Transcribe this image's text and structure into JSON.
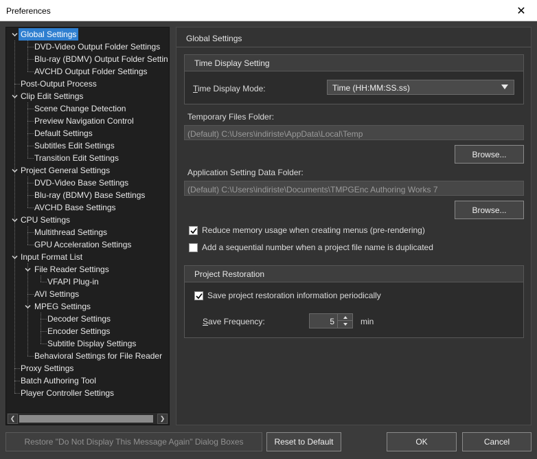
{
  "window": {
    "title": "Preferences"
  },
  "tree": {
    "items": [
      {
        "label": "Global Settings",
        "depth": 0,
        "toggle": "expanded",
        "selected": true
      },
      {
        "label": "DVD-Video Output Folder Settings",
        "depth": 1
      },
      {
        "label": "Blu-ray (BDMV) Output Folder Settin",
        "depth": 1
      },
      {
        "label": "AVCHD Output Folder Settings",
        "depth": 1
      },
      {
        "label": "Post-Output Process",
        "depth": 0
      },
      {
        "label": "Clip Edit Settings",
        "depth": 0,
        "toggle": "expanded"
      },
      {
        "label": "Scene Change Detection",
        "depth": 1
      },
      {
        "label": "Preview Navigation Control",
        "depth": 1
      },
      {
        "label": "Default Settings",
        "depth": 1
      },
      {
        "label": "Subtitles Edit Settings",
        "depth": 1
      },
      {
        "label": "Transition Edit Settings",
        "depth": 1
      },
      {
        "label": "Project General Settings",
        "depth": 0,
        "toggle": "expanded"
      },
      {
        "label": "DVD-Video Base Settings",
        "depth": 1
      },
      {
        "label": "Blu-ray (BDMV) Base Settings",
        "depth": 1
      },
      {
        "label": "AVCHD Base Settings",
        "depth": 1
      },
      {
        "label": "CPU Settings",
        "depth": 0,
        "toggle": "expanded"
      },
      {
        "label": "Multithread Settings",
        "depth": 1
      },
      {
        "label": "GPU Acceleration Settings",
        "depth": 1
      },
      {
        "label": "Input Format List",
        "depth": 0,
        "toggle": "expanded"
      },
      {
        "label": "File Reader Settings",
        "depth": 1,
        "toggle": "expanded"
      },
      {
        "label": "VFAPI Plug-in",
        "depth": 2
      },
      {
        "label": "AVI Settings",
        "depth": 1
      },
      {
        "label": "MPEG Settings",
        "depth": 1,
        "toggle": "expanded"
      },
      {
        "label": "Decoder Settings",
        "depth": 2
      },
      {
        "label": "Encoder Settings",
        "depth": 2
      },
      {
        "label": "Subtitle Display Settings",
        "depth": 2
      },
      {
        "label": "Behavioral Settings for File Reader",
        "depth": 1
      },
      {
        "label": "Proxy Settings",
        "depth": 0
      },
      {
        "label": "Batch Authoring Tool",
        "depth": 0
      },
      {
        "label": "Player Controller Settings",
        "depth": 0
      }
    ]
  },
  "panel": {
    "title": "Global Settings",
    "time_display": {
      "header": "Time Display Setting",
      "mode_label_u": "T",
      "mode_label_rest": "ime Display Mode:",
      "mode_value": "Time (HH:MM:SS.ss)"
    },
    "temp_folder": {
      "label": "Temporary Files Folder:",
      "value": "(Default) C:\\Users\\indiriste\\AppData\\Local\\Temp",
      "browse": "Browse..."
    },
    "app_folder": {
      "label": "Application Setting Data Folder:",
      "value": "(Default) C:\\Users\\indiriste\\Documents\\TMPGEnc Authoring Works 7",
      "browse": "Browse..."
    },
    "options": {
      "reduce_memory": {
        "label": "Reduce memory usage when creating menus (pre-rendering)",
        "checked": true
      },
      "sequential_number": {
        "label": "Add a sequential number when a project file name is duplicated",
        "checked": false
      }
    },
    "restoration": {
      "header": "Project Restoration",
      "save_periodically": {
        "label": "Save project restoration information periodically",
        "checked": true
      },
      "frequency_label_u": "S",
      "frequency_label_rest": "ave Frequency:",
      "frequency_value": "5",
      "frequency_unit": "min"
    }
  },
  "footer": {
    "restore_label": "Restore \"Do Not Display This Message Again\" Dialog Boxes",
    "reset_label": "Reset to Default",
    "ok_label": "OK",
    "cancel_label": "Cancel"
  }
}
